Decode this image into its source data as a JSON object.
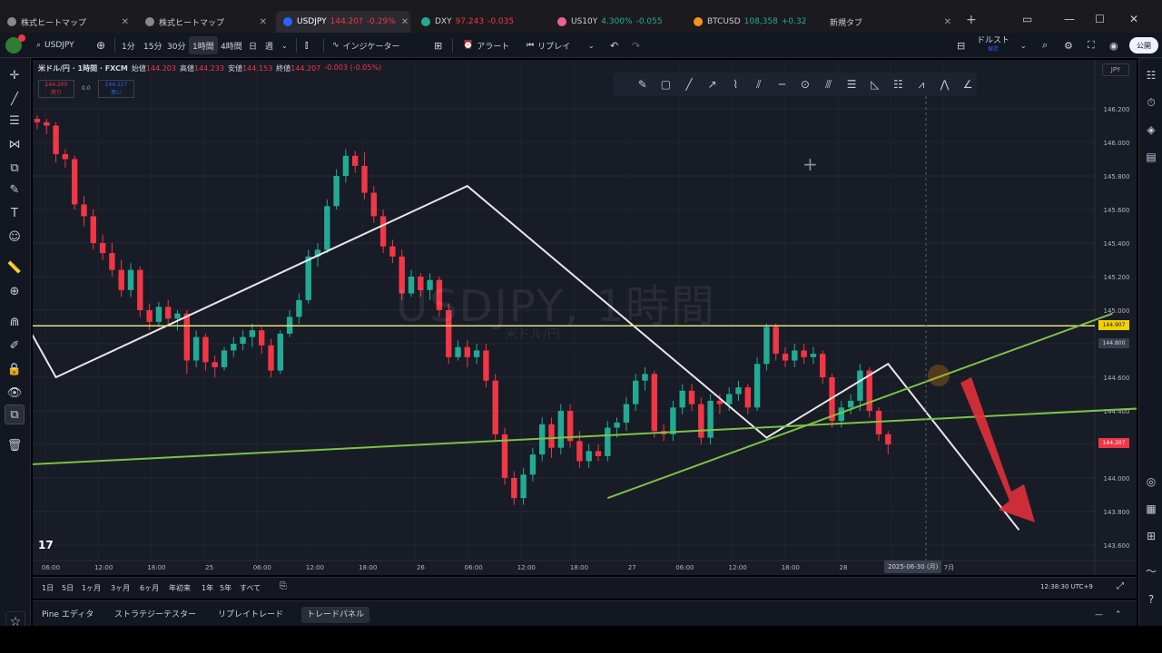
{
  "browser": {
    "tabs": [
      {
        "title": "株式ヒートマップ",
        "fav": "#888888",
        "active": false
      },
      {
        "title": "株式ヒートマップ",
        "fav": "#888888",
        "active": false
      },
      {
        "title": "USDJPY",
        "price": "144.20?",
        "change": "-0.29%",
        "dir": "down",
        "fav": "#2962ff",
        "active": true
      },
      {
        "title": "DXY",
        "price": "97.243",
        "change": "-0.035",
        "dir": "down",
        "fav": "#22ab94",
        "active": false
      },
      {
        "title": "US10Y",
        "price": "4.300%",
        "change": "-0.055",
        "dir": "up",
        "fav": "#f06292",
        "active": false
      },
      {
        "title": "BTCUSD",
        "price": "108,358",
        "change": "+0.32",
        "dir": "up",
        "fav": "#f7931a",
        "active": false
      },
      {
        "title": "新規タブ",
        "fav": "",
        "active": false
      }
    ]
  },
  "toolbar": {
    "symbol": "USDJPY",
    "intervals": [
      "1分",
      "15分",
      "30分",
      "1時間",
      "4時間",
      "日",
      "週"
    ],
    "selected_interval": "1時間",
    "indicators": "インジケーター",
    "alert": "アラート",
    "replay": "リプレイ",
    "layout_name": "ドルスト",
    "layout_sub": "保存",
    "publish": "公開"
  },
  "chart": {
    "title": "米ドル/円 · 1時間 · FXCM",
    "ohlc": [
      {
        "k": "始値",
        "v": "144.203"
      },
      {
        "k": "高値",
        "v": "144.233"
      },
      {
        "k": "安値",
        "v": "144.153"
      },
      {
        "k": "終値",
        "v": "144.207"
      },
      {
        "k": "",
        "v": "-0.003 (-0.05%)"
      }
    ],
    "sell": {
      "price": "144.205",
      "label": "売り"
    },
    "spread": "0.0",
    "buy": {
      "price": "144.227",
      "label": "買い"
    },
    "watermark": "USDJPY, 1時間",
    "watermark_sub": "米ドル/円",
    "currency": "JPY",
    "price_axis": [
      "146.200",
      "146.000",
      "145.800",
      "145.600",
      "145.400",
      "145.200",
      "145.000",
      "144.800",
      "144.600",
      "144.400",
      "144.200",
      "144.000",
      "143.800",
      "143.600"
    ],
    "time_axis": [
      "06:00",
      "12:00",
      "18:00",
      "25",
      "06:00",
      "12:00",
      "18:00",
      "26",
      "06:00",
      "12:00",
      "18:00",
      "27",
      "06:00",
      "12:00",
      "18:00",
      "28",
      "20:00",
      "7月"
    ],
    "cursor_time": "2025-06-30 (月)",
    "price_tags": [
      {
        "value": "144.907",
        "bg": "#f5d000",
        "fg": "#131722"
      },
      {
        "value": "144.800",
        "bg": "#3a3f4c",
        "fg": "#d1d4dc"
      },
      {
        "value": "144.207",
        "bg": "#f23645",
        "fg": "#ffffff"
      }
    ],
    "colors": {
      "up": "#22ab94",
      "down": "#f23645",
      "white_line": "#e8e8e8",
      "green_line": "#7cc243",
      "yellow_line": "#e8e07a",
      "arrow": "#e0303a"
    }
  },
  "chart_data": {
    "type": "candlestick",
    "title": "米ドル/円 · 1時間 · FXCM",
    "ylim": [
      143.55,
      146.33
    ],
    "candles": [
      {
        "o": 146.14,
        "h": 146.16,
        "l": 146.08,
        "c": 146.12
      },
      {
        "o": 146.12,
        "h": 146.14,
        "l": 146.05,
        "c": 146.1
      },
      {
        "o": 146.1,
        "h": 146.12,
        "l": 145.88,
        "c": 145.93
      },
      {
        "o": 145.93,
        "h": 145.96,
        "l": 145.85,
        "c": 145.9
      },
      {
        "o": 145.9,
        "h": 145.92,
        "l": 145.6,
        "c": 145.63
      },
      {
        "o": 145.63,
        "h": 145.68,
        "l": 145.5,
        "c": 145.56
      },
      {
        "o": 145.56,
        "h": 145.6,
        "l": 145.36,
        "c": 145.4
      },
      {
        "o": 145.4,
        "h": 145.45,
        "l": 145.3,
        "c": 145.34
      },
      {
        "o": 145.34,
        "h": 145.4,
        "l": 145.2,
        "c": 145.24
      },
      {
        "o": 145.24,
        "h": 145.3,
        "l": 145.08,
        "c": 145.12
      },
      {
        "o": 145.12,
        "h": 145.28,
        "l": 145.08,
        "c": 145.24
      },
      {
        "o": 145.24,
        "h": 145.26,
        "l": 144.96,
        "c": 145.0
      },
      {
        "o": 145.0,
        "h": 145.04,
        "l": 144.88,
        "c": 144.93
      },
      {
        "o": 144.93,
        "h": 145.05,
        "l": 144.9,
        "c": 145.02
      },
      {
        "o": 145.02,
        "h": 145.06,
        "l": 144.92,
        "c": 144.95
      },
      {
        "o": 144.95,
        "h": 145.0,
        "l": 144.88,
        "c": 144.98
      },
      {
        "o": 144.98,
        "h": 145.0,
        "l": 144.62,
        "c": 144.7
      },
      {
        "o": 144.7,
        "h": 144.88,
        "l": 144.66,
        "c": 144.84
      },
      {
        "o": 144.84,
        "h": 144.86,
        "l": 144.64,
        "c": 144.69
      },
      {
        "o": 144.69,
        "h": 144.73,
        "l": 144.6,
        "c": 144.66
      },
      {
        "o": 144.66,
        "h": 144.78,
        "l": 144.64,
        "c": 144.76
      },
      {
        "o": 144.76,
        "h": 144.84,
        "l": 144.72,
        "c": 144.8
      },
      {
        "o": 144.8,
        "h": 144.88,
        "l": 144.76,
        "c": 144.84
      },
      {
        "o": 144.84,
        "h": 144.92,
        "l": 144.78,
        "c": 144.88
      },
      {
        "o": 144.88,
        "h": 144.9,
        "l": 144.74,
        "c": 144.79
      },
      {
        "o": 144.79,
        "h": 144.83,
        "l": 144.6,
        "c": 144.64
      },
      {
        "o": 144.64,
        "h": 144.88,
        "l": 144.62,
        "c": 144.86
      },
      {
        "o": 144.86,
        "h": 145.0,
        "l": 144.84,
        "c": 144.96
      },
      {
        "o": 144.96,
        "h": 145.1,
        "l": 144.92,
        "c": 145.06
      },
      {
        "o": 145.06,
        "h": 145.36,
        "l": 145.04,
        "c": 145.32
      },
      {
        "o": 145.32,
        "h": 145.4,
        "l": 145.26,
        "c": 145.36
      },
      {
        "o": 145.36,
        "h": 145.66,
        "l": 145.34,
        "c": 145.62
      },
      {
        "o": 145.62,
        "h": 145.84,
        "l": 145.6,
        "c": 145.8
      },
      {
        "o": 145.8,
        "h": 145.96,
        "l": 145.76,
        "c": 145.92
      },
      {
        "o": 145.92,
        "h": 145.95,
        "l": 145.82,
        "c": 145.86
      },
      {
        "o": 145.86,
        "h": 145.94,
        "l": 145.66,
        "c": 145.7
      },
      {
        "o": 145.7,
        "h": 145.74,
        "l": 145.52,
        "c": 145.56
      },
      {
        "o": 145.56,
        "h": 145.6,
        "l": 145.34,
        "c": 145.38
      },
      {
        "o": 145.38,
        "h": 145.42,
        "l": 145.28,
        "c": 145.32
      },
      {
        "o": 145.32,
        "h": 145.36,
        "l": 145.06,
        "c": 145.1
      },
      {
        "o": 145.1,
        "h": 145.24,
        "l": 145.08,
        "c": 145.2
      },
      {
        "o": 145.2,
        "h": 145.22,
        "l": 145.08,
        "c": 145.12
      },
      {
        "o": 145.12,
        "h": 145.22,
        "l": 145.06,
        "c": 145.18
      },
      {
        "o": 145.18,
        "h": 145.2,
        "l": 144.96,
        "c": 145.0
      },
      {
        "o": 145.0,
        "h": 145.04,
        "l": 144.68,
        "c": 144.72
      },
      {
        "o": 144.72,
        "h": 144.82,
        "l": 144.7,
        "c": 144.78
      },
      {
        "o": 144.78,
        "h": 144.82,
        "l": 144.66,
        "c": 144.72
      },
      {
        "o": 144.72,
        "h": 144.8,
        "l": 144.68,
        "c": 144.76
      },
      {
        "o": 144.76,
        "h": 144.8,
        "l": 144.54,
        "c": 144.58
      },
      {
        "o": 144.58,
        "h": 144.62,
        "l": 144.22,
        "c": 144.26
      },
      {
        "o": 144.26,
        "h": 144.3,
        "l": 143.96,
        "c": 144.0
      },
      {
        "o": 144.0,
        "h": 144.04,
        "l": 143.84,
        "c": 143.88
      },
      {
        "o": 143.88,
        "h": 144.06,
        "l": 143.84,
        "c": 144.02
      },
      {
        "o": 144.02,
        "h": 144.18,
        "l": 143.98,
        "c": 144.14
      },
      {
        "o": 144.14,
        "h": 144.36,
        "l": 144.1,
        "c": 144.32
      },
      {
        "o": 144.32,
        "h": 144.36,
        "l": 144.12,
        "c": 144.18
      },
      {
        "o": 144.18,
        "h": 144.44,
        "l": 144.14,
        "c": 144.4
      },
      {
        "o": 144.4,
        "h": 144.44,
        "l": 144.18,
        "c": 144.22
      },
      {
        "o": 144.22,
        "h": 144.28,
        "l": 144.06,
        "c": 144.1
      },
      {
        "o": 144.1,
        "h": 144.2,
        "l": 144.06,
        "c": 144.16
      },
      {
        "o": 144.16,
        "h": 144.2,
        "l": 144.1,
        "c": 144.13
      },
      {
        "o": 144.13,
        "h": 144.34,
        "l": 144.1,
        "c": 144.3
      },
      {
        "o": 144.3,
        "h": 144.36,
        "l": 144.24,
        "c": 144.33
      },
      {
        "o": 144.33,
        "h": 144.48,
        "l": 144.28,
        "c": 144.44
      },
      {
        "o": 144.44,
        "h": 144.62,
        "l": 144.4,
        "c": 144.58
      },
      {
        "o": 144.58,
        "h": 144.66,
        "l": 144.52,
        "c": 144.62
      },
      {
        "o": 144.62,
        "h": 144.64,
        "l": 144.24,
        "c": 144.28
      },
      {
        "o": 144.28,
        "h": 144.32,
        "l": 144.22,
        "c": 144.26
      },
      {
        "o": 144.26,
        "h": 144.46,
        "l": 144.22,
        "c": 144.42
      },
      {
        "o": 144.42,
        "h": 144.56,
        "l": 144.38,
        "c": 144.52
      },
      {
        "o": 144.52,
        "h": 144.56,
        "l": 144.4,
        "c": 144.44
      },
      {
        "o": 144.44,
        "h": 144.48,
        "l": 144.2,
        "c": 144.24
      },
      {
        "o": 144.24,
        "h": 144.5,
        "l": 144.2,
        "c": 144.46
      },
      {
        "o": 144.46,
        "h": 144.5,
        "l": 144.38,
        "c": 144.44
      },
      {
        "o": 144.44,
        "h": 144.54,
        "l": 144.4,
        "c": 144.5
      },
      {
        "o": 144.5,
        "h": 144.58,
        "l": 144.46,
        "c": 144.54
      },
      {
        "o": 144.54,
        "h": 144.56,
        "l": 144.38,
        "c": 144.42
      },
      {
        "o": 144.42,
        "h": 144.72,
        "l": 144.4,
        "c": 144.68
      },
      {
        "o": 144.68,
        "h": 144.92,
        "l": 144.64,
        "c": 144.9
      },
      {
        "o": 144.9,
        "h": 144.92,
        "l": 144.7,
        "c": 144.74
      },
      {
        "o": 144.74,
        "h": 144.78,
        "l": 144.66,
        "c": 144.7
      },
      {
        "o": 144.7,
        "h": 144.8,
        "l": 144.66,
        "c": 144.76
      },
      {
        "o": 144.76,
        "h": 144.8,
        "l": 144.68,
        "c": 144.72
      },
      {
        "o": 144.72,
        "h": 144.78,
        "l": 144.68,
        "c": 144.74
      },
      {
        "o": 144.74,
        "h": 144.76,
        "l": 144.56,
        "c": 144.6
      },
      {
        "o": 144.6,
        "h": 144.62,
        "l": 144.3,
        "c": 144.34
      },
      {
        "o": 144.34,
        "h": 144.46,
        "l": 144.3,
        "c": 144.42
      },
      {
        "o": 144.42,
        "h": 144.5,
        "l": 144.38,
        "c": 144.46
      },
      {
        "o": 144.46,
        "h": 144.68,
        "l": 144.4,
        "c": 144.64
      },
      {
        "o": 144.64,
        "h": 144.66,
        "l": 144.36,
        "c": 144.4
      },
      {
        "o": 144.4,
        "h": 144.42,
        "l": 144.22,
        "c": 144.26
      },
      {
        "o": 144.26,
        "h": 144.28,
        "l": 144.14,
        "c": 144.2
      }
    ],
    "overlays": [
      {
        "type": "zigzag",
        "color": "white",
        "points": [
          [
            -1,
            144.9
          ],
          [
            2,
            144.6
          ],
          [
            46,
            145.74
          ],
          [
            78,
            144.24
          ],
          [
            91,
            144.68
          ],
          [
            105,
            143.69
          ]
        ]
      },
      {
        "type": "hline",
        "color": "yellow",
        "price": 144.907
      },
      {
        "type": "trendline",
        "color": "green",
        "points": [
          [
            -1,
            144.08
          ],
          [
            120,
            144.42
          ]
        ]
      },
      {
        "type": "trendline",
        "color": "green",
        "points": [
          [
            61,
            143.88
          ],
          [
            115,
            144.98
          ]
        ]
      },
      {
        "type": "arrow",
        "color": "red",
        "direction": "down"
      }
    ]
  },
  "range_bar": {
    "ranges": [
      "1日",
      "5日",
      "1ヶ月",
      "3ヶ月",
      "6ヶ月",
      "年初来",
      "1年",
      "5年",
      "すべて"
    ],
    "clock": "12:38:30 UTC+9"
  },
  "bottom_tabs": [
    "Pine エディタ",
    "ストラテジーテスター",
    "リプレイトレード",
    "トレードパネル"
  ],
  "selected_bottom_tab": "トレードパネル"
}
